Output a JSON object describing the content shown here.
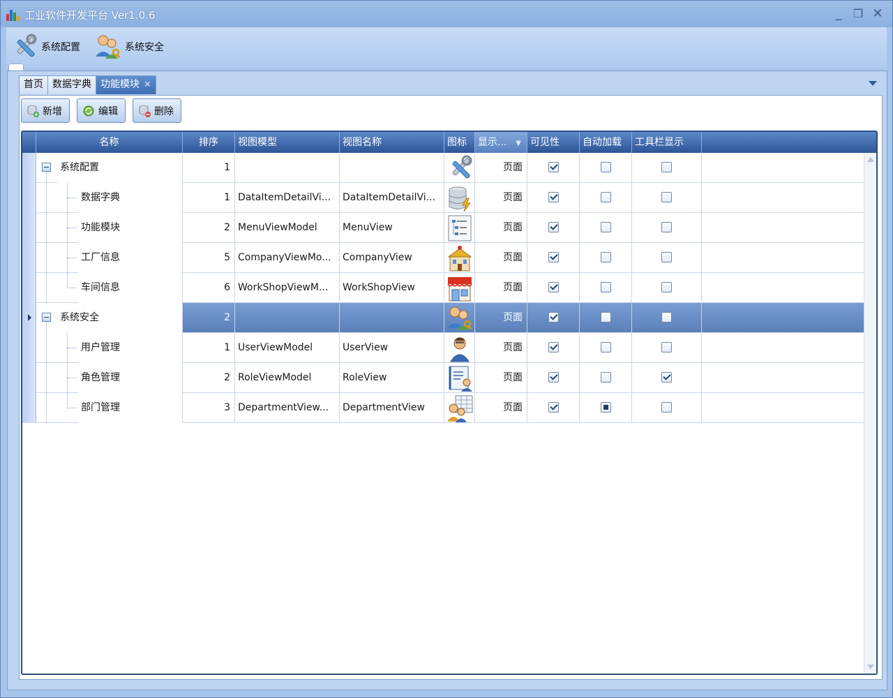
{
  "window": {
    "title": "工业软件开发平台 Ver1.0.6",
    "controls": {
      "minimize": "_",
      "maximize": "❐",
      "close": "✕"
    }
  },
  "ribbon": {
    "items": [
      {
        "label": "系统配置",
        "icon": "tools-icon"
      },
      {
        "label": "系统安全",
        "icon": "users-key-icon"
      }
    ]
  },
  "tabs": [
    {
      "label": "首页",
      "active": false
    },
    {
      "label": "数据字典",
      "active": false
    },
    {
      "label": "功能模块",
      "active": true,
      "closable": true
    }
  ],
  "toolbar": {
    "add_label": "新增",
    "edit_label": "编辑",
    "delete_label": "删除"
  },
  "grid": {
    "columns": {
      "name": "名称",
      "order": "排序",
      "viewmodel": "视图模型",
      "viewname": "视图名称",
      "icon": "图标",
      "display": "显示...",
      "visible": "可见性",
      "autoload": "自动加载",
      "toolbar": "工具栏显示"
    },
    "rows": [
      {
        "name": "系统配置",
        "order": "1",
        "viewmodel": "",
        "viewname": "",
        "icon": "tools-icon",
        "display": "页面",
        "visible": true,
        "autoload": "unchecked",
        "toolbar": false,
        "level": 0
      },
      {
        "name": "数据字典",
        "order": "1",
        "viewmodel": "DataItemDetailVi...",
        "viewname": "DataItemDetailVi...",
        "icon": "database-icon",
        "display": "页面",
        "visible": true,
        "autoload": "unchecked",
        "toolbar": false,
        "level": 1
      },
      {
        "name": "功能模块",
        "order": "2",
        "viewmodel": "MenuViewModel",
        "viewname": "MenuView",
        "icon": "tree-list-icon",
        "display": "页面",
        "visible": true,
        "autoload": "unchecked",
        "toolbar": false,
        "level": 1
      },
      {
        "name": "工厂信息",
        "order": "5",
        "viewmodel": "CompanyViewMo...",
        "viewname": "CompanyView",
        "icon": "factory-icon",
        "display": "页面",
        "visible": true,
        "autoload": "unchecked",
        "toolbar": false,
        "level": 1
      },
      {
        "name": "车间信息",
        "order": "6",
        "viewmodel": "WorkShopViewM...",
        "viewname": "WorkShopView",
        "icon": "shop-icon",
        "display": "页面",
        "visible": true,
        "autoload": "unchecked",
        "toolbar": false,
        "level": 1
      },
      {
        "name": "系统安全",
        "order": "2",
        "viewmodel": "",
        "viewname": "",
        "icon": "users-key-icon",
        "display": "页面",
        "visible": true,
        "autoload": "unchecked",
        "toolbar": false,
        "level": 0,
        "selected": true
      },
      {
        "name": "用户管理",
        "order": "1",
        "viewmodel": "UserViewModel",
        "viewname": "UserView",
        "icon": "user-icon",
        "display": "页面",
        "visible": true,
        "autoload": "unchecked",
        "toolbar": false,
        "level": 1
      },
      {
        "name": "角色管理",
        "order": "2",
        "viewmodel": "RoleViewModel",
        "viewname": "RoleView",
        "icon": "role-book-icon",
        "display": "页面",
        "visible": true,
        "autoload": "unchecked",
        "toolbar": true,
        "level": 1
      },
      {
        "name": "部门管理",
        "order": "3",
        "viewmodel": "DepartmentView...",
        "viewname": "DepartmentView",
        "icon": "department-icon",
        "display": "页面",
        "visible": true,
        "autoload": "indeterminate",
        "toolbar": false,
        "level": 1
      }
    ]
  },
  "colors": {
    "title_bar": "#8bb0e0",
    "header": "#2d5596",
    "selected_row": "#5a7fba",
    "panel": "#bed4f0"
  }
}
